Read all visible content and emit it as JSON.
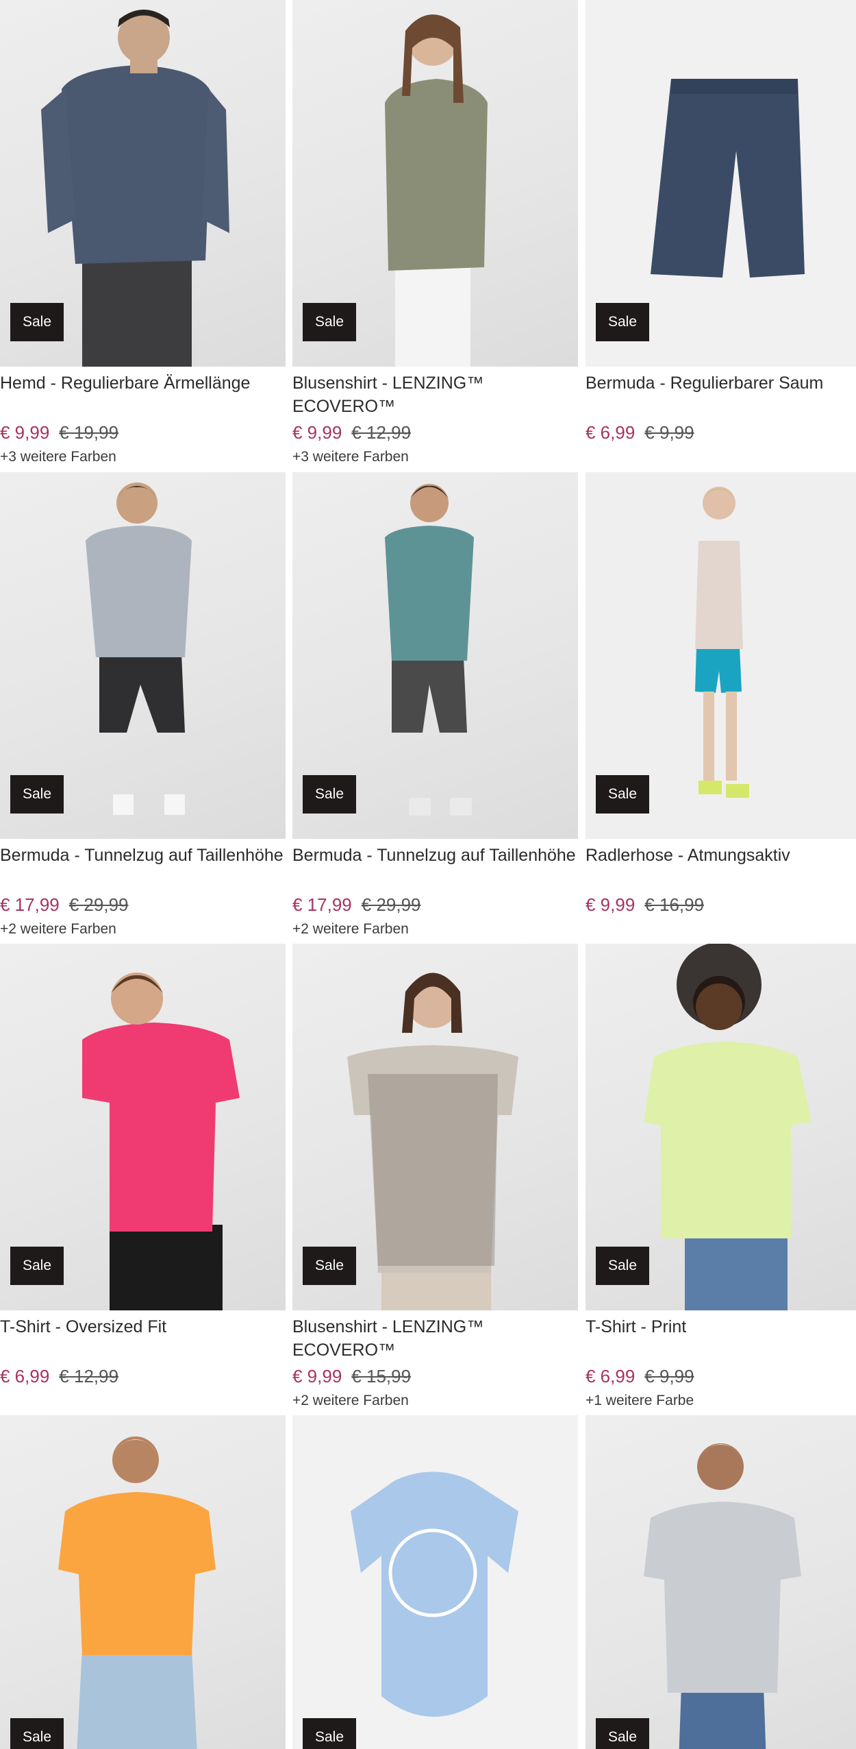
{
  "products": [
    {
      "title": "Hemd - Regulierbare Ärmellänge",
      "badge": "Sale",
      "price": "€ 9,99",
      "old_price": "€ 19,99",
      "colors": "+3 weitere Farben",
      "image": "man-paisley-shirt"
    },
    {
      "title": "Blusenshirt - LENZING™ ECOVERO™",
      "badge": "Sale",
      "price": "€ 9,99",
      "old_price": "€ 12,99",
      "colors": "+3 weitere Farben",
      "image": "woman-olive-print-blouse"
    },
    {
      "title": "Bermuda - Regulierbarer Saum",
      "badge": "Sale",
      "price": "€ 6,99",
      "old_price": "€ 9,99",
      "colors": "",
      "image": "denim-bermuda"
    },
    {
      "title": "Bermuda - Tunnelzug auf Taillenhöhe",
      "badge": "Sale",
      "price": "€ 17,99",
      "old_price": "€ 29,99",
      "colors": "+2 weitere Farben",
      "image": "man-grey-shirt-black-shorts"
    },
    {
      "title": "Bermuda - Tunnelzug auf Taillenhöhe",
      "badge": "Sale",
      "price": "€ 17,99",
      "old_price": "€ 29,99",
      "colors": "+2 weitere Farben",
      "image": "man-teal-shirt-grey-shorts"
    },
    {
      "title": "Radlerhose - Atmungsaktiv",
      "badge": "Sale",
      "price": "€ 9,99",
      "old_price": "€ 16,99",
      "colors": "",
      "image": "woman-tank-turquoise-cycling-shorts"
    },
    {
      "title": "T-Shirt - Oversized Fit",
      "badge": "Sale",
      "price": "€ 6,99",
      "old_price": "€ 12,99",
      "colors": "",
      "image": "man-pink-tshirt"
    },
    {
      "title": "Blusenshirt - LENZING™ ECOVERO™",
      "badge": "Sale",
      "price": "€ 9,99",
      "old_price": "€ 15,99",
      "colors": "+2 weitere Farben",
      "image": "woman-animal-print-blouse"
    },
    {
      "title": "T-Shirt - Print",
      "badge": "Sale",
      "price": "€ 6,99",
      "old_price": "€ 9,99",
      "colors": "+1 weitere Farbe",
      "image": "woman-lime-print-tshirt"
    },
    {
      "title": "",
      "badge": "Sale",
      "price": "",
      "old_price": "",
      "colors": "",
      "image": "woman-orange-rib-top"
    },
    {
      "title": "",
      "badge": "Sale",
      "price": "",
      "old_price": "",
      "colors": "",
      "image": "baby-blue-bodysuit"
    },
    {
      "title": "",
      "badge": "Sale",
      "price": "",
      "old_price": "",
      "colors": "",
      "image": "woman-grey-rib-top"
    }
  ],
  "colors": {
    "sale_badge": "#1d1a19",
    "price": "#a83262"
  }
}
